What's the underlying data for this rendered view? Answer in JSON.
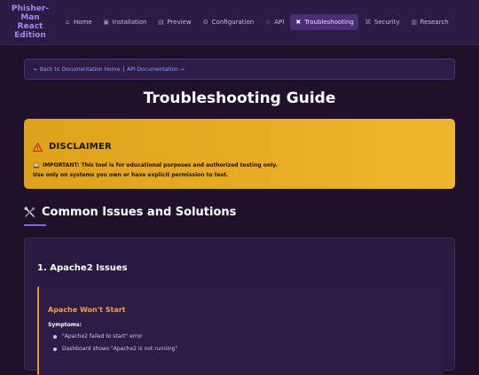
{
  "brand": "Phisher-\nMan\nReact\nEdition",
  "nav": {
    "items": [
      {
        "icon": "⌂",
        "icon_name": "home-icon",
        "label": "Home",
        "active": false
      },
      {
        "icon": "▣",
        "icon_name": "installation-icon",
        "label": "Installation",
        "active": false
      },
      {
        "icon": "▤",
        "icon_name": "preview-icon",
        "label": "Preview",
        "active": false
      },
      {
        "icon": "⚙",
        "icon_name": "gear-icon",
        "label": "Configuration",
        "active": false
      },
      {
        "icon": "☆",
        "icon_name": "api-icon",
        "label": "API",
        "active": false
      },
      {
        "icon": "✖",
        "icon_name": "tools-icon",
        "label": "Troubleshooting",
        "active": true
      },
      {
        "icon": "⌘",
        "icon_name": "security-icon",
        "label": "Security",
        "active": false
      },
      {
        "icon": "▥",
        "icon_name": "research-icon",
        "label": "Research",
        "active": false
      }
    ]
  },
  "breadcrumb": {
    "back_link": "← Back to Documentation Home",
    "separator": "|",
    "api_link": "API Documentation →"
  },
  "page_title": "Troubleshooting Guide",
  "disclaimer": {
    "title": "DISCLAIMER",
    "line1": "IMPORTANT: This tool is for educational purposes and authorized testing only.",
    "line2": "Use only on systems you own or have explicit permission to test."
  },
  "section": {
    "title": "Common Issues and Solutions"
  },
  "card": {
    "title": "1. Apache2 Issues",
    "issue": {
      "title": "Apache Won't Start",
      "symptoms_label": "Symptoms:",
      "symptoms": [
        "\"Apache2 failed to start\" error",
        "Dashboard shows \"Apache2 is not running\""
      ]
    }
  },
  "colors": {
    "background": "#1e1129",
    "navbar": "#2d1a45",
    "accent": "#8b5cf6",
    "disclaimer": "#efb52c",
    "issue_accent": "#e09a22"
  }
}
